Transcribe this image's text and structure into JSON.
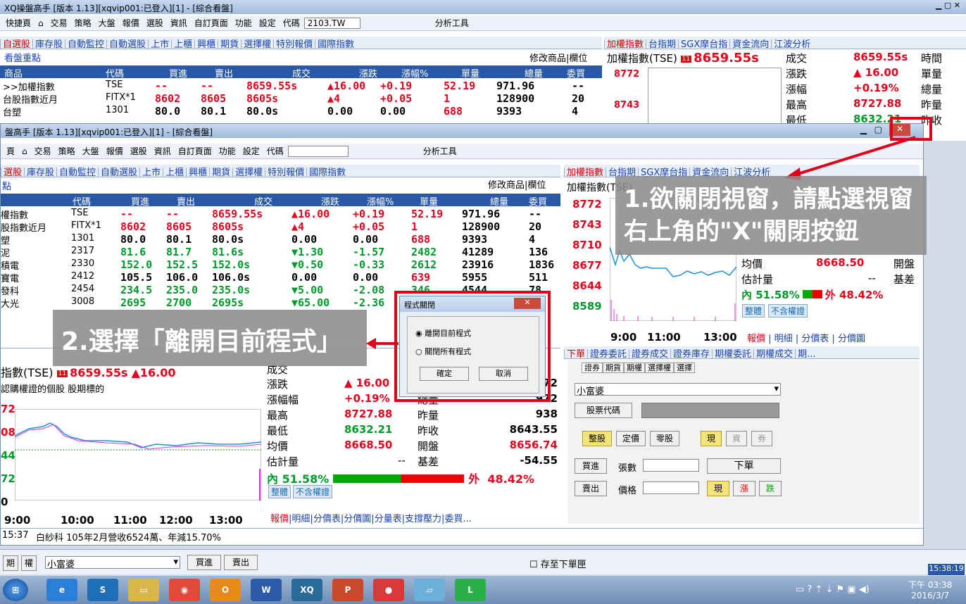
{
  "back": {
    "title": "XQ操盤高手 [版本 1.13][xqvip001:已登入][1] - [綜合看盤]",
    "quick": "快捷頁",
    "menu": [
      "交易",
      "策略",
      "大盤",
      "報價",
      "選股",
      "資訊",
      "自訂頁面",
      "功能",
      "設定",
      "代碼"
    ],
    "code_value": "2103.TW",
    "analysis": "分析工具",
    "tabs": [
      "自選股",
      "庫存股",
      "自動監控",
      "自動選股",
      "上市",
      "上櫃",
      "興櫃",
      "期貨",
      "選擇權",
      "特別報價",
      "國際指數"
    ],
    "focus": "看盤重點",
    "modify": "修改商品",
    "col": "欄位",
    "cols": [
      "商品",
      "代碼",
      "買進",
      "賣出",
      "成交",
      "漲跌",
      "漲幅%",
      "單量",
      "總量",
      "委買"
    ],
    "rows": [
      {
        "name": ">>加權指數",
        "code": "TSE",
        "bid": "--",
        "ask": "--",
        "last": "8659.55s",
        "chg": "▲16.00",
        "pct": "+0.19",
        "vol": "52.19",
        "tot": "971.96",
        "bq": "--"
      },
      {
        "name": "台股指數近月",
        "code": "FITX*1",
        "bid": "8602",
        "ask": "8605",
        "last": "8605s",
        "chg": "▲4",
        "pct": "+0.05",
        "vol": "1",
        "tot": "128900",
        "bq": "20"
      },
      {
        "name": "台塑",
        "code": "1301",
        "bid": "80.0",
        "ask": "80.1",
        "last": "80.0s",
        "chg": "0.00",
        "pct": "0.00",
        "vol": "688",
        "tot": "9393",
        "bq": "4"
      }
    ],
    "right_tabs": [
      "加權指數",
      "台指期",
      "SGX摩台指",
      "資金流向",
      "江波分析"
    ],
    "idx_name": "加權指數(TSE)",
    "idx_val": "8659.55s",
    "quote": [
      [
        "成交",
        "8659.55s",
        "時間"
      ],
      [
        "漲跌",
        "▲ 16.00",
        "單量"
      ],
      [
        "漲幅",
        "+0.19%",
        "總量"
      ],
      [
        "最高",
        "8727.88",
        "昨量"
      ],
      [
        "最低",
        "8632.21",
        "昨收"
      ]
    ],
    "yticks": [
      "8772",
      "8743"
    ]
  },
  "front": {
    "title": "盤高手 [版本 1.13][xqvip001:已登入][1] - [綜合看盤]",
    "menu": [
      "交易",
      "策略",
      "大盤",
      "報價",
      "選股",
      "資訊",
      "自訂頁面",
      "功能",
      "設定",
      "代碼"
    ],
    "analysis": "分析工具",
    "quick": "頁",
    "tabs": [
      "選股",
      "庫存股",
      "自動監控",
      "自動選股",
      "上市",
      "上櫃",
      "興櫃",
      "期貨",
      "選擇權",
      "特別報價",
      "國際指數"
    ],
    "focus": "點",
    "modify": "修改商品",
    "col": "欄位",
    "cols": [
      "代碼",
      "買進",
      "賣出",
      "成交",
      "漲跌",
      "漲幅%",
      "單量",
      "總量",
      "委買"
    ],
    "rows": [
      {
        "name": "權指數",
        "code": "TSE",
        "bid": "--",
        "ask": "--",
        "last": "8659.55s",
        "chg": "▲16.00",
        "pct": "+0.19",
        "vol": "52.19",
        "tot": "971.96",
        "bq": "--"
      },
      {
        "name": "股指數近月",
        "code": "FITX*1",
        "bid": "8602",
        "ask": "8605",
        "last": "8605s",
        "chg": "▲4",
        "pct": "+0.05",
        "vol": "1",
        "tot": "128900",
        "bq": "20"
      },
      {
        "name": "塑",
        "code": "1301",
        "bid": "80.0",
        "ask": "80.1",
        "last": "80.0s",
        "chg": "0.00",
        "pct": "0.00",
        "vol": "688",
        "tot": "9393",
        "bq": "4"
      },
      {
        "name": "泥",
        "code": "2317",
        "bid": "81.6",
        "ask": "81.7",
        "last": "81.6s",
        "chg": "▼1.30",
        "pct": "-1.57",
        "vol": "2482",
        "tot": "41289",
        "bq": "136"
      },
      {
        "name": "積電",
        "code": "2330",
        "bid": "152.0",
        "ask": "152.5",
        "last": "152.0s",
        "chg": "▼0.50",
        "pct": "-0.33",
        "vol": "2612",
        "tot": "23916",
        "bq": "1836"
      },
      {
        "name": "寶電",
        "code": "2412",
        "bid": "105.5",
        "ask": "106.0",
        "last": "106.0s",
        "chg": "0.00",
        "pct": "0.00",
        "vol": "639",
        "tot": "5955",
        "bq": "511"
      },
      {
        "name": "發科",
        "code": "2454",
        "bid": "234.5",
        "ask": "235.0",
        "last": "235.0s",
        "chg": "▼5.00",
        "pct": "-2.08",
        "vol": "346",
        "tot": "4544",
        "bq": "78"
      },
      {
        "name": "大光",
        "code": "3008",
        "bid": "2695",
        "ask": "2700",
        "last": "2695s",
        "chg": "▼65.00",
        "pct": "-2.36",
        "vol": "",
        "tot": "",
        "bq": ""
      }
    ],
    "idx_tabs": [
      "加權指數",
      "台指期",
      "SGX摩台指",
      "資金流向",
      "江波分析"
    ],
    "idx_name": "加權指數(TSE)",
    "yticks": [
      "8772",
      "8743",
      "8710",
      "8677",
      "8644",
      "8589"
    ],
    "xticks": [
      "9:00",
      "11:00",
      "13:00"
    ],
    "right_quote": [
      [
        "均價",
        "8668.50",
        "開盤"
      ],
      [
        "估計量",
        "--",
        "基差"
      ]
    ],
    "inner": "51.58%",
    "outer": "48.42%",
    "in_lbl": "內",
    "out_lbl": "外",
    "chip1": "整體",
    "chip2": "不含權證",
    "sub_tabs": [
      "報價",
      "明細",
      "分價表",
      "分價圖"
    ],
    "bl_title": "成交",
    "bl_idx": "指數(TSE)",
    "bl_val": "8659.55s",
    "bl_chg": "▲16.00",
    "bl_sub": "認購權證的個股   股期標的",
    "bl_yticks": [
      "72",
      "08",
      "44",
      "72",
      "0"
    ],
    "bl_xticks": [
      "9:00",
      "10:00",
      "11:00",
      "12:00",
      "13:00"
    ],
    "bl_quote": [
      [
        "漲跌",
        "▲ 16.00",
        "總量",
        "972"
      ],
      [
        "漲幅幅",
        "+0.19%",
        "總量",
        "972"
      ],
      [
        "最高",
        "8727.88",
        "昨量",
        "938"
      ],
      [
        "最低",
        "8632.21",
        "昨收",
        "8643.55"
      ],
      [
        "均價",
        "8668.50",
        "開盤",
        "8656.74"
      ],
      [
        "估計量",
        "--",
        "基差",
        "-54.55"
      ]
    ],
    "bl_tabs": [
      "報價",
      "明細",
      "分價表",
      "分價圖",
      "分量表",
      "支撐壓力",
      "委買..."
    ],
    "order_tabs": [
      "下單",
      "證券委託",
      "證券成交",
      "證券庫存",
      "期權委託",
      "期權成交",
      "期..."
    ],
    "acct_tabs": [
      "證券",
      "期貨",
      "期權",
      "選擇權",
      "選擇"
    ],
    "user": "小富婆",
    "stock_code_btn": "股票代碼",
    "trade_types": [
      "整股",
      "定價",
      "零股"
    ],
    "mkt": [
      "現",
      "資",
      "券"
    ],
    "buy": "買進",
    "sell": "賣出",
    "qty": "張數",
    "price": "價格",
    "place": "下單",
    "now": "現",
    "up": "漲",
    "down": "跌",
    "news_time": "15:37",
    "news": "白紗科 105年2月營收6524萬、年減15.70%",
    "bottom": [
      "期",
      "權"
    ],
    "save_chk": "存至下單匣",
    "clock": "15:38:19"
  },
  "dialog": {
    "title": "程式關閉",
    "opt1": "離開目前程式",
    "opt2": "關閉所有程式",
    "ok": "確定",
    "cancel": "取消"
  },
  "callouts": {
    "c1a": "1.欲關閉視窗，請點選視窗",
    "c1b": "右上角的\"X\"關閉按鈕",
    "c2": "2.選擇「離開目前程式」"
  },
  "taskbar": {
    "time": "下午 03:38",
    "date": "2016/3/7"
  }
}
